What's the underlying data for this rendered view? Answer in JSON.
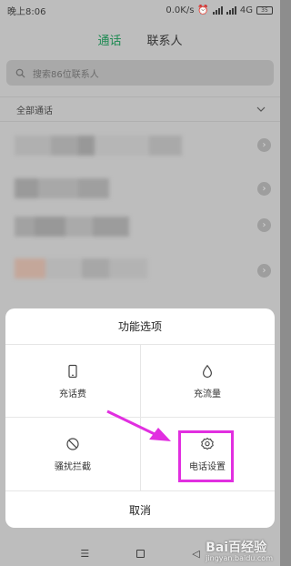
{
  "status_bar": {
    "time": "晚上8:06",
    "network_speed": "0.0K/s",
    "network_type": "4G",
    "battery": "35"
  },
  "tabs": [
    {
      "label": "通话",
      "active": true
    },
    {
      "label": "联系人",
      "active": false
    }
  ],
  "search": {
    "placeholder": "搜索86位联系人"
  },
  "filter": {
    "label": "全部通话"
  },
  "sheet": {
    "title": "功能选项",
    "options": [
      {
        "label": "充话费",
        "icon": "phone-icon"
      },
      {
        "label": "充流量",
        "icon": "droplet-icon"
      },
      {
        "label": "骚扰拦截",
        "icon": "block-icon"
      },
      {
        "label": "电话设置",
        "icon": "gear-icon"
      }
    ],
    "cancel": "取消"
  },
  "colors": {
    "accent": "#1d8a52",
    "highlight": "#e12fe0"
  },
  "watermark": {
    "brand": "Bai百经验",
    "url": "jingyan.baidu.com"
  }
}
